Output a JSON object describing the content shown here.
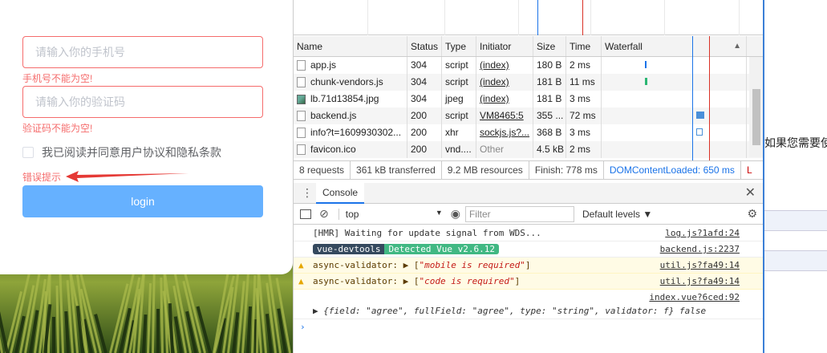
{
  "login": {
    "phone_placeholder": "请输入你的手机号",
    "phone_error": "手机号不能为空!",
    "code_placeholder": "请输入你的验证码",
    "code_error": "验证码不能为空!",
    "agree_label": "我已阅读并同意用户协议和隐私条款",
    "hint": "错误提示",
    "login_button": "login"
  },
  "network": {
    "columns": [
      "Name",
      "Status",
      "Type",
      "Initiator",
      "Size",
      "Time",
      "Waterfall"
    ],
    "rows": [
      {
        "name": "app.js",
        "status": "304",
        "type": "script",
        "initiator": "(index)",
        "size": "180 B",
        "time": "2 ms"
      },
      {
        "name": "chunk-vendors.js",
        "status": "304",
        "type": "script",
        "initiator": "(index)",
        "size": "181 B",
        "time": "11 ms"
      },
      {
        "name": "lb.71d13854.jpg",
        "status": "304",
        "type": "jpeg",
        "initiator": "(index)",
        "size": "181 B",
        "time": "3 ms"
      },
      {
        "name": "backend.js",
        "status": "200",
        "type": "script",
        "initiator": "VM8465:5",
        "size": "355 ...",
        "time": "72 ms"
      },
      {
        "name": "info?t=1609930302...",
        "status": "200",
        "type": "xhr",
        "initiator": "sockjs.js?...",
        "size": "368 B",
        "time": "3 ms"
      },
      {
        "name": "favicon.ico",
        "status": "200",
        "type": "vnd....",
        "initiator": "Other",
        "size": "4.5 kB",
        "time": "2 ms"
      }
    ],
    "summary": {
      "requests": "8 requests",
      "transferred": "361 kB transferred",
      "resources": "9.2 MB resources",
      "finish": "Finish: 778 ms",
      "dcl": "DOMContentLoaded: 650 ms",
      "load": "L"
    }
  },
  "drawer": {
    "tab": "Console",
    "context": "top",
    "filter_placeholder": "Filter",
    "levels": "Default levels ▼"
  },
  "console": {
    "line1": "[HMR] Waiting for update signal from WDS...",
    "line1_src": "log.js?1afd:24",
    "badge_left": "vue-devtools",
    "badge_right": "Detected Vue v2.6.12",
    "line2_src": "backend.js:2237",
    "warn1_prefix": "async-validator: ▶ [",
    "warn1_str": "\"mobile is required\"",
    "warn1_suffix": "]",
    "warn1_src": "util.js?fa49:14",
    "warn2_prefix": "async-validator: ▶ [",
    "warn2_str": "\"code is required\"",
    "warn2_suffix": "]",
    "warn2_src": "util.js?fa49:14",
    "line5_src": "index.vue?6ced:92",
    "obj_text": "▶ {field: \"agree\", fullField: \"agree\", type: \"string\", validator: f} false"
  },
  "right": {
    "text": "如果您需要使"
  }
}
